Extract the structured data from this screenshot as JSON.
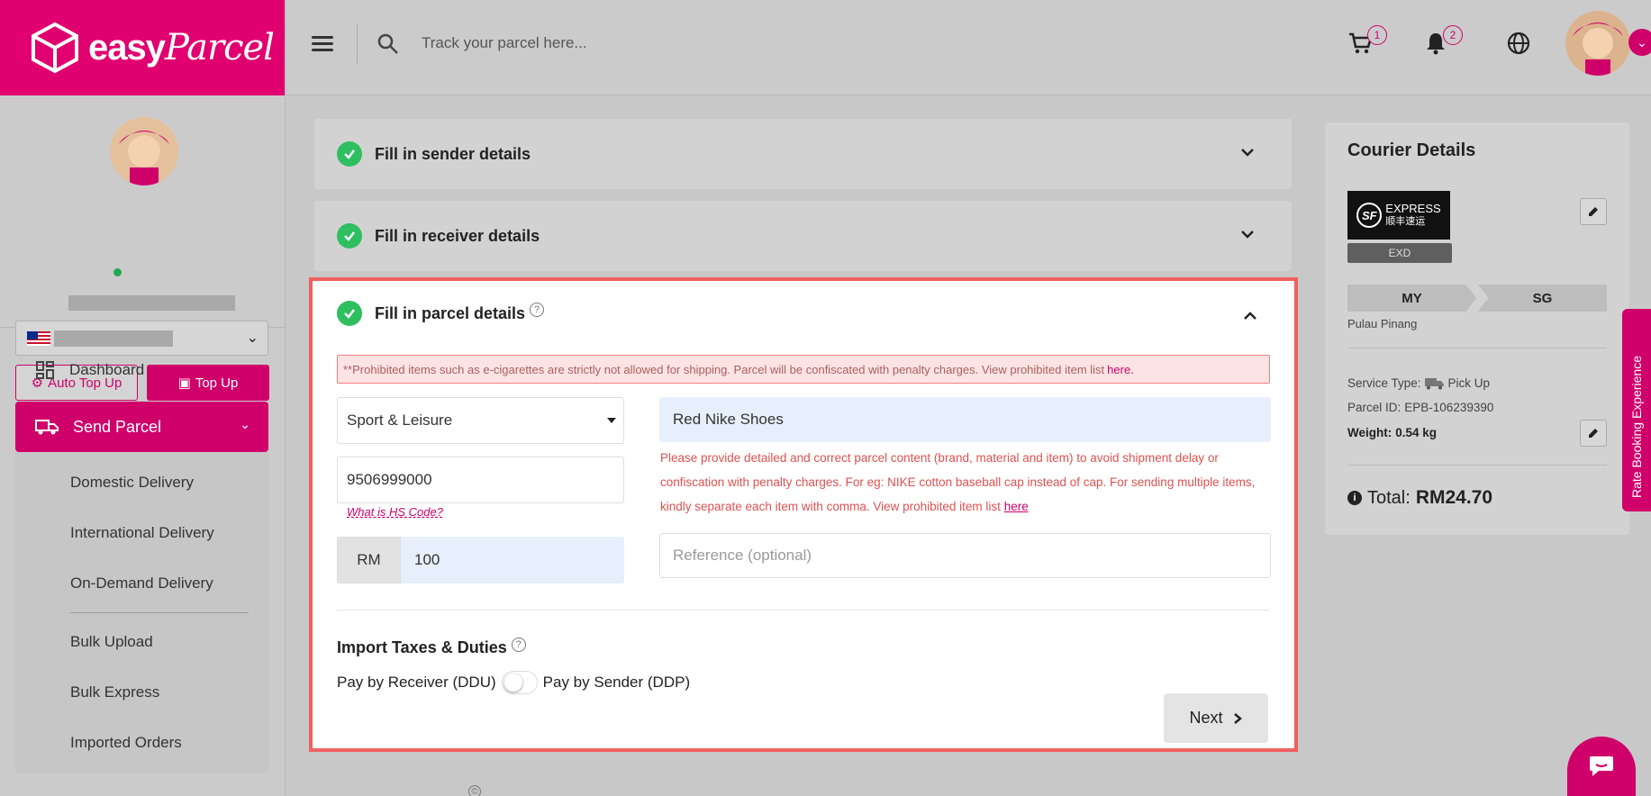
{
  "app": {
    "logo_word1": "easy",
    "logo_word2": "Parcel"
  },
  "sidebar": {
    "auto_topup_label": "Auto Top Up",
    "topup_label": "Top Up",
    "nav": {
      "dashboard": "Dashboard",
      "send_parcel": "Send Parcel",
      "sub_items": [
        "Domestic Delivery",
        "International Delivery",
        "On-Demand Delivery",
        "Bulk Upload",
        "Bulk Express",
        "Imported Orders"
      ]
    }
  },
  "header": {
    "search_placeholder": "Track your parcel here...",
    "cart_count": "1",
    "notification_count": "2"
  },
  "steps": {
    "sender": "Fill in sender details",
    "receiver": "Fill in receiver details",
    "parcel": "Fill in parcel details"
  },
  "parcel_form": {
    "warning_text": "**Prohibited items such as e-cigarettes are strictly not allowed for shipping. Parcel will be confiscated with penalty charges. View prohibited item list",
    "warning_link": "here.",
    "category_value": "Sport & Leisure",
    "content_value": "Red Nike Shoes",
    "hs_code_value": "9506999000",
    "hs_code_link": "What is HS Code?",
    "currency": "RM",
    "value_amount": "100",
    "hint_text": "Please provide detailed and correct parcel content (brand, material and item) to avoid shipment delay or confiscation with penalty charges. For eg: NIKE cotton baseball cap instead of cap. For sending multiple items, kindly separate each item with comma. View prohibited item list",
    "hint_link": "here",
    "reference_placeholder": "Reference (optional)",
    "import_taxes_title": "Import Taxes & Duties",
    "pay_receiver": "Pay by Receiver (DDU)",
    "pay_sender": "Pay by Sender (DDP)",
    "next_label": "Next"
  },
  "courier": {
    "title": "Courier Details",
    "logo_text_en": "EXPRESS",
    "logo_text_zh": "顺丰速运",
    "logo_mark": "SF",
    "service_code": "EXD",
    "from_country": "MY",
    "to_country": "SG",
    "origin_city": "Pulau Pinang",
    "service_type_label": "Service Type:",
    "service_type_value": "Pick Up",
    "parcel_id_label": "Parcel ID:",
    "parcel_id_value": "EPB-106239390",
    "weight_label": "Weight:",
    "weight_value": "0.54 kg",
    "total_label": "Total:",
    "total_value": "RM24.70"
  },
  "rate_tab_label": "Rate Booking Experience",
  "colors": {
    "brand": "#e0006f",
    "success": "#2fbe60",
    "warning_border": "#f06060"
  }
}
